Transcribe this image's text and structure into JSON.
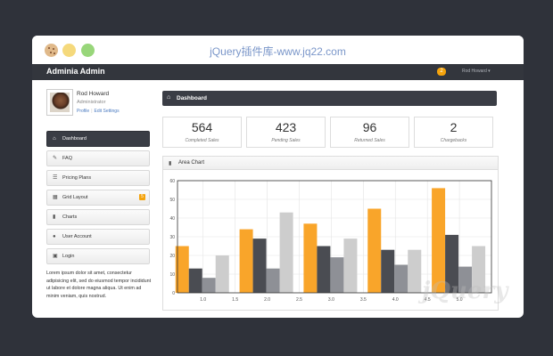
{
  "site": {
    "title": "jQuery插件库-www.jq22.com",
    "watermark": "jQuery"
  },
  "app": {
    "brand": "Adminia Admin",
    "notification_count": "2",
    "user_menu": "Rod Howard ▾"
  },
  "profile": {
    "name": "Rod Howard",
    "role": "Administrator",
    "link_profile": "Profile",
    "link_settings": "Edit Settings"
  },
  "nav": {
    "items": [
      {
        "label": "Dashboard",
        "icon": "home-icon"
      },
      {
        "label": "FAQ",
        "icon": "pushpin-icon"
      },
      {
        "label": "Pricing Plans",
        "icon": "th-list-icon"
      },
      {
        "label": "Grid Layout",
        "icon": "th-large-icon",
        "badge": "5"
      },
      {
        "label": "Charts",
        "icon": "signal-icon"
      },
      {
        "label": "User Account",
        "icon": "user-icon"
      },
      {
        "label": "Login",
        "icon": "lock-icon"
      }
    ]
  },
  "sidebar_text": "Lorem ipsum dolor sit amet, consectetur adipisicing elit, sed do eiusmod tempor incididunt ut labore et dolore magna aliqua. Ut enim ad minim veniam, quis nostrud.",
  "dashboard": {
    "title": "Dashboard"
  },
  "stats": [
    {
      "value": "564",
      "label": "Completed Sales"
    },
    {
      "value": "423",
      "label": "Pending Sales"
    },
    {
      "value": "96",
      "label": "Returned Sales"
    },
    {
      "value": "2",
      "label": "Chargebacks"
    }
  ],
  "chart_data": {
    "type": "bar",
    "title": "Area Chart",
    "x": [
      1.0,
      1.5,
      2.0,
      2.5,
      3.0,
      3.5,
      4.0,
      4.5,
      5.0
    ],
    "x_tick_labels": [
      "1.0",
      "1.5",
      "2.0",
      "2.5",
      "3.0",
      "3.5",
      "4.0",
      "4.5",
      "5.0"
    ],
    "ylim": [
      0,
      60
    ],
    "y_ticks": [
      0,
      10,
      20,
      30,
      40,
      50,
      60
    ],
    "grid": true,
    "groups": [
      {
        "x": 1.0,
        "values": [
          25,
          13,
          8,
          20
        ]
      },
      {
        "x": 2.0,
        "values": [
          34,
          29,
          13,
          43
        ]
      },
      {
        "x": 3.0,
        "values": [
          37,
          25,
          19,
          29
        ]
      },
      {
        "x": 4.0,
        "values": [
          45,
          23,
          15,
          23
        ]
      },
      {
        "x": 5.0,
        "values": [
          56,
          31,
          14,
          25
        ]
      }
    ],
    "colors": [
      "#f9a52a",
      "#4a4c52",
      "#8e9096",
      "#cdcdcd"
    ]
  }
}
